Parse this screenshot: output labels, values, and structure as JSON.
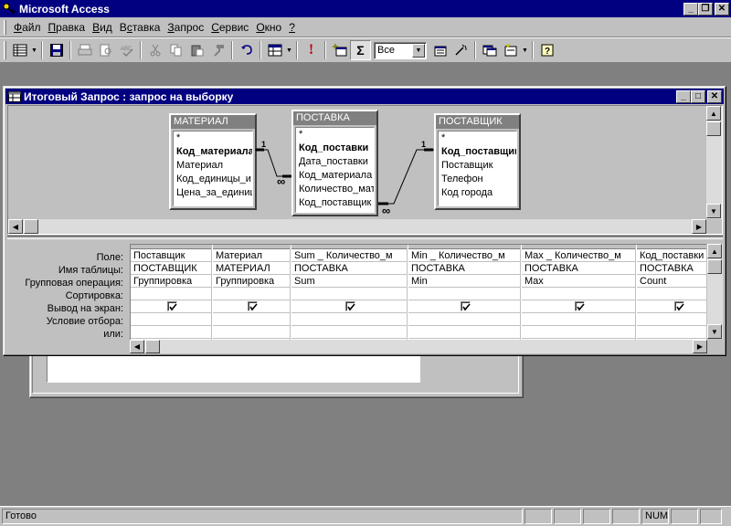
{
  "app": {
    "title": "Microsoft Access"
  },
  "menu": [
    {
      "label": "Файл",
      "accel": "Ф",
      "rest": "айл"
    },
    {
      "label": "Правка",
      "accel": "П",
      "rest": "равка"
    },
    {
      "label": "Вид",
      "accel": "В",
      "rest": "ид"
    },
    {
      "label": "Вставка",
      "accel": "с",
      "pre": "В",
      "rest": "тавка"
    },
    {
      "label": "Запрос",
      "accel": "З",
      "rest": "апрос"
    },
    {
      "label": "Сервис",
      "accel": "С",
      "rest": "ервис"
    },
    {
      "label": "Окно",
      "accel": "О",
      "rest": "кно"
    },
    {
      "label": "?",
      "accel": "?",
      "rest": ""
    }
  ],
  "toolbar": {
    "top_values": "Все",
    "icons": [
      "view-icon",
      "save-icon",
      "print-icon",
      "print-preview-icon",
      "spelling-icon",
      "cut-icon",
      "copy-icon",
      "paste-icon",
      "format-painter-icon",
      "undo-icon",
      "query-type-icon",
      "run-icon",
      "show-table-icon",
      "totals-icon",
      "properties-icon",
      "build-icon",
      "database-window-icon",
      "new-object-icon",
      "help-icon"
    ],
    "totals_glyph": "Σ",
    "run_glyph": "!"
  },
  "query_window": {
    "title": "Итоговый Запрос : запрос на выборку",
    "tables": [
      {
        "name": "МАТЕРИАЛ",
        "fields": [
          "*",
          "Код_материала",
          "Материал",
          "Код_единицы_и",
          "Цена_за_единиц"
        ],
        "key": 1
      },
      {
        "name": "ПОСТАВКА",
        "fields": [
          "*",
          "Код_поставки",
          "Дата_поставки",
          "Код_материала",
          "Количество_мат",
          "Код_поставщик"
        ],
        "key": 1
      },
      {
        "name": "ПОСТАВЩИК",
        "fields": [
          "*",
          "Код_поставщик",
          "Поставщик",
          "Телефон",
          "Код города"
        ],
        "key": 1
      }
    ],
    "relations": [
      {
        "one": "1",
        "many": "∞"
      },
      {
        "one": "1",
        "many": "∞"
      }
    ],
    "grid": {
      "row_labels": [
        "Поле:",
        "Имя таблицы:",
        "Групповая операция:",
        "Сортировка:",
        "Вывод на экран:",
        "Условие отбора:",
        "или:"
      ],
      "columns": [
        {
          "field": "Поставщик",
          "table": "ПОСТАВЩИК",
          "total": "Группировка",
          "sort": "",
          "show": true
        },
        {
          "field": "Материал",
          "table": "МАТЕРИАЛ",
          "total": "Группировка",
          "sort": "",
          "show": true
        },
        {
          "field": "Sum _ Количество_м",
          "table": "ПОСТАВКА",
          "total": "Sum",
          "sort": "",
          "show": true
        },
        {
          "field": "Min _ Количество_м",
          "table": "ПОСТАВКА",
          "total": "Min",
          "sort": "",
          "show": true
        },
        {
          "field": "Max _ Количество_м",
          "table": "ПОСТАВКА",
          "total": "Max",
          "sort": "",
          "show": true
        },
        {
          "field": "Код_поставки",
          "table": "ПОСТАВКА",
          "total": "Count",
          "sort": "",
          "show": true
        }
      ]
    }
  },
  "status": {
    "text": "Готово",
    "num": "NUM"
  }
}
